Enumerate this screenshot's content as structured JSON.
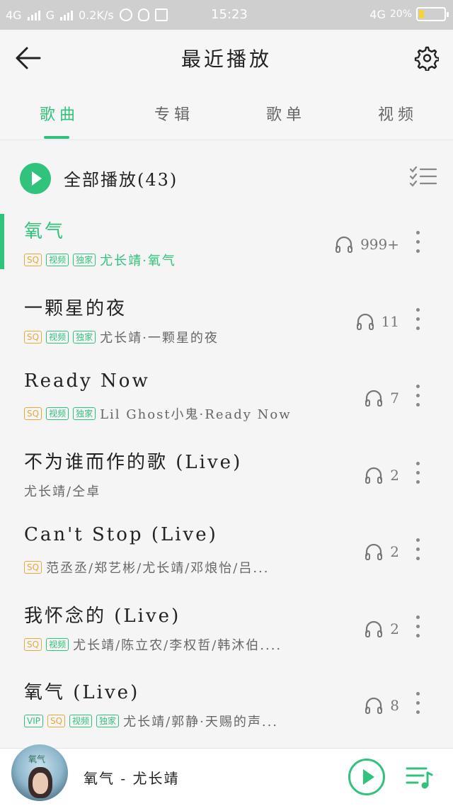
{
  "status_bar": {
    "network_left": "4G",
    "carrier2": "G",
    "speed": "0.2K/s",
    "time": "15:23",
    "network_right": "4G",
    "battery": "20%",
    "battery_level": 0.2
  },
  "header": {
    "title": "最近播放"
  },
  "tabs": [
    {
      "label": "歌曲",
      "active": true
    },
    {
      "label": "专辑",
      "active": false
    },
    {
      "label": "歌单",
      "active": false
    },
    {
      "label": "视频",
      "active": false
    }
  ],
  "play_all": {
    "label": "全部播放(43)"
  },
  "songs": [
    {
      "title": "氧气",
      "badges": [
        "SQ",
        "视频",
        "独家"
      ],
      "subtitle": "尤长靖·氧气",
      "plays": "999+",
      "active": true
    },
    {
      "title": "一颗星的夜",
      "badges": [
        "SQ",
        "视频",
        "独家"
      ],
      "subtitle": "尤长靖·一颗星的夜",
      "plays": "11",
      "active": false
    },
    {
      "title": "Ready Now",
      "badges": [
        "SQ",
        "视频",
        "独家"
      ],
      "subtitle": "Lil Ghost小鬼·Ready Now",
      "plays": "7",
      "active": false
    },
    {
      "title": "不为谁而作的歌 (Live)",
      "badges": [],
      "subtitle": "尤长靖/仝卓",
      "plays": "2",
      "active": false
    },
    {
      "title": "Can't Stop (Live)",
      "badges": [
        "SQ"
      ],
      "subtitle": "范丞丞/郑艺彬/尤长靖/邓烺怡/吕...",
      "plays": "2",
      "active": false
    },
    {
      "title": "我怀念的 (Live)",
      "badges": [
        "SQ",
        "视频"
      ],
      "subtitle": "尤长靖/陈立农/李权哲/韩沐伯....",
      "plays": "2",
      "active": false
    },
    {
      "title": "氧气 (Live)",
      "badges": [
        "VIP",
        "SQ",
        "视频",
        "独家"
      ],
      "subtitle": "尤长靖/郭静·天赐的声...",
      "plays": "8",
      "active": false
    }
  ],
  "player": {
    "cover_text": "氧气",
    "now_playing": "氧气 - 尤长靖"
  },
  "colors": {
    "accent": "#31c27c",
    "sq": "#e7a93a"
  }
}
